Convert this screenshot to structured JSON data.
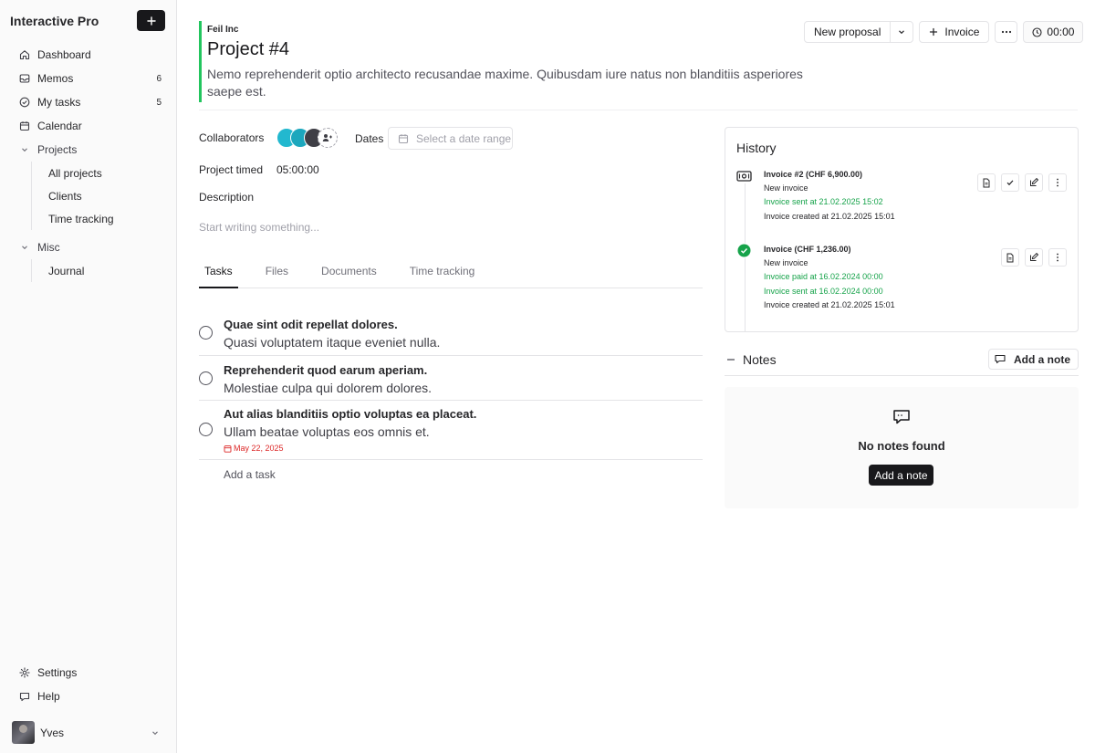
{
  "app": {
    "name": "Interactive Pro"
  },
  "sidebar": {
    "items": [
      {
        "label": "Dashboard",
        "icon": "home-icon"
      },
      {
        "label": "Memos",
        "count": "6",
        "icon": "inbox-icon"
      },
      {
        "label": "My tasks",
        "count": "5",
        "icon": "check-circle-icon"
      },
      {
        "label": "Calendar",
        "icon": "calendar-icon"
      }
    ],
    "groups": [
      {
        "label": "Projects",
        "items": [
          "All projects",
          "Clients",
          "Time tracking"
        ]
      },
      {
        "label": "Misc",
        "items": [
          "Journal"
        ]
      }
    ],
    "bottom": [
      {
        "label": "Settings",
        "icon": "gear-icon"
      },
      {
        "label": "Help",
        "icon": "chat-icon"
      }
    ],
    "user": {
      "name": "Yves"
    }
  },
  "project": {
    "company": "Feil Inc",
    "title": "Project #4",
    "description": "Nemo reprehenderit optio architecto recusandae maxime. Quibusdam iure natus non blanditiis asperiores saepe est.",
    "accent": "#22c55e"
  },
  "toolbar": {
    "new_proposal": "New proposal",
    "invoice": "Invoice",
    "timer": "00:00"
  },
  "meta": {
    "collaborators_label": "Collaborators",
    "dates_label": "Dates",
    "dates_placeholder": "Select a date range",
    "timed_label": "Project timed",
    "timed_value": "05:00:00",
    "description_label": "Description",
    "editor_placeholder": "Start writing something..."
  },
  "tabs": [
    "Tasks",
    "Files",
    "Documents",
    "Time tracking"
  ],
  "tasks": [
    {
      "title": "Quae sint odit repellat dolores.",
      "subtitle": "Quasi voluptatem itaque eveniet nulla."
    },
    {
      "title": "Reprehenderit quod earum aperiam.",
      "subtitle": "Molestiae culpa qui dolorem dolores."
    },
    {
      "title": "Aut alias blanditiis optio voluptas ea placeat.",
      "subtitle": "Ullam beatae voluptas eos omnis et.",
      "due": "May 22, 2025"
    }
  ],
  "add_task": "Add a task",
  "history": {
    "title": "History",
    "entries": [
      {
        "heading": "Invoice #2 (CHF 6,900.00)",
        "lines": [
          {
            "text": "New invoice",
            "tone": "default"
          },
          {
            "text": "Invoice sent at 21.02.2025 15:02",
            "tone": "green"
          },
          {
            "text": "Invoice created at 21.02.2025 15:01",
            "tone": "default"
          }
        ]
      },
      {
        "heading": "Invoice (CHF 1,236.00)",
        "lines": [
          {
            "text": "New invoice",
            "tone": "default"
          },
          {
            "text": "Invoice paid at 16.02.2024 00:00",
            "tone": "green"
          },
          {
            "text": "Invoice sent at 16.02.2024 00:00",
            "tone": "green"
          },
          {
            "text": "Invoice created at 21.02.2025 15:01",
            "tone": "default"
          }
        ]
      }
    ]
  },
  "notes": {
    "title": "Notes",
    "add_label": "Add a note",
    "empty_text": "No notes found",
    "empty_button": "Add a note"
  }
}
